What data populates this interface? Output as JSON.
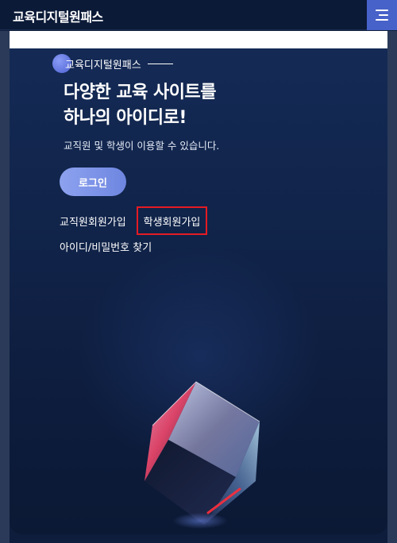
{
  "header": {
    "logo": "교육디지털원패스",
    "menu_icon": "hamburger-menu-icon"
  },
  "hero": {
    "brand_label": "교육디지털원패스",
    "title_line1": "다양한 교육 사이트를",
    "title_line2": "하나의 아이디로!",
    "subtitle": "교직원 및 학생이 이용할 수 있습니다.",
    "login_label": "로그인",
    "links": {
      "teacher_signup": "교직원회원가입",
      "student_signup": "학생회원가입",
      "find_account": "아이디/비밀번호 찾기"
    }
  },
  "colors": {
    "accent": "#4762c9",
    "login_button": "#7c93e8",
    "highlight_box": "#e51b23",
    "background": "#0e1d3b"
  }
}
